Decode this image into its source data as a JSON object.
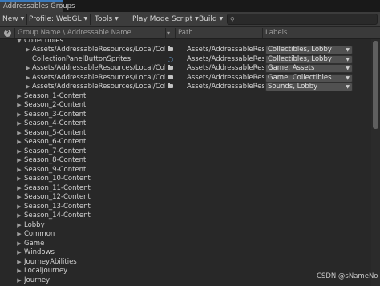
{
  "window": {
    "tab_title": "Addressables Groups"
  },
  "toolbar": {
    "new_label": "New",
    "profile_label": "Profile: WebGL",
    "tools_label": "Tools",
    "play_mode_label": "Play Mode Script",
    "build_label": "Build",
    "search_placeholder": ""
  },
  "columns": {
    "name": "Group Name \\ Addressable Name",
    "path": "Path",
    "labels": "Labels"
  },
  "expanded_group": {
    "name": "Collectibles",
    "entries": [
      {
        "name": "Assets/AddressableResources/Local/Coll",
        "icon": "folder-icon",
        "path": "Assets/AddressableRes",
        "labels": "Collectibles, Lobby",
        "expandable": true
      },
      {
        "name": "CollectionPanelButtonSprites",
        "icon": "prefab-icon",
        "path": "Assets/AddressableRes",
        "labels": "Collectibles, Lobby",
        "expandable": false
      },
      {
        "name": "Assets/AddressableResources/Local/Coll",
        "icon": "folder-icon",
        "path": "Assets/AddressableRes",
        "labels": "Game, Assets",
        "expandable": true
      },
      {
        "name": "Assets/AddressableResources/Local/Coll",
        "icon": "folder-icon",
        "path": "Assets/AddressableRes",
        "labels": "Game, Collectibles",
        "expandable": true
      },
      {
        "name": "Assets/AddressableResources/Local/Coll",
        "icon": "folder-icon",
        "path": "Assets/AddressableRes",
        "labels": "Sounds, Lobby",
        "expandable": true
      }
    ]
  },
  "groups": [
    "Season_1-Content",
    "Season_2-Content",
    "Season_3-Content",
    "Season_4-Content",
    "Season_5-Content",
    "Season_6-Content",
    "Season_7-Content",
    "Season_8-Content",
    "Season_9-Content",
    "Season_10-Content",
    "Season_11-Content",
    "Season_12-Content",
    "Season_13-Content",
    "Season_14-Content",
    "Lobby",
    "Common",
    "Game",
    "Windows",
    "JourneyAbilities",
    "LocalJourney",
    "Journey"
  ],
  "watermark": "CSDN @sNameNo",
  "colors": {
    "accent": "#3a79bb",
    "background": "#282828",
    "toolbar": "#3c3c3c"
  }
}
